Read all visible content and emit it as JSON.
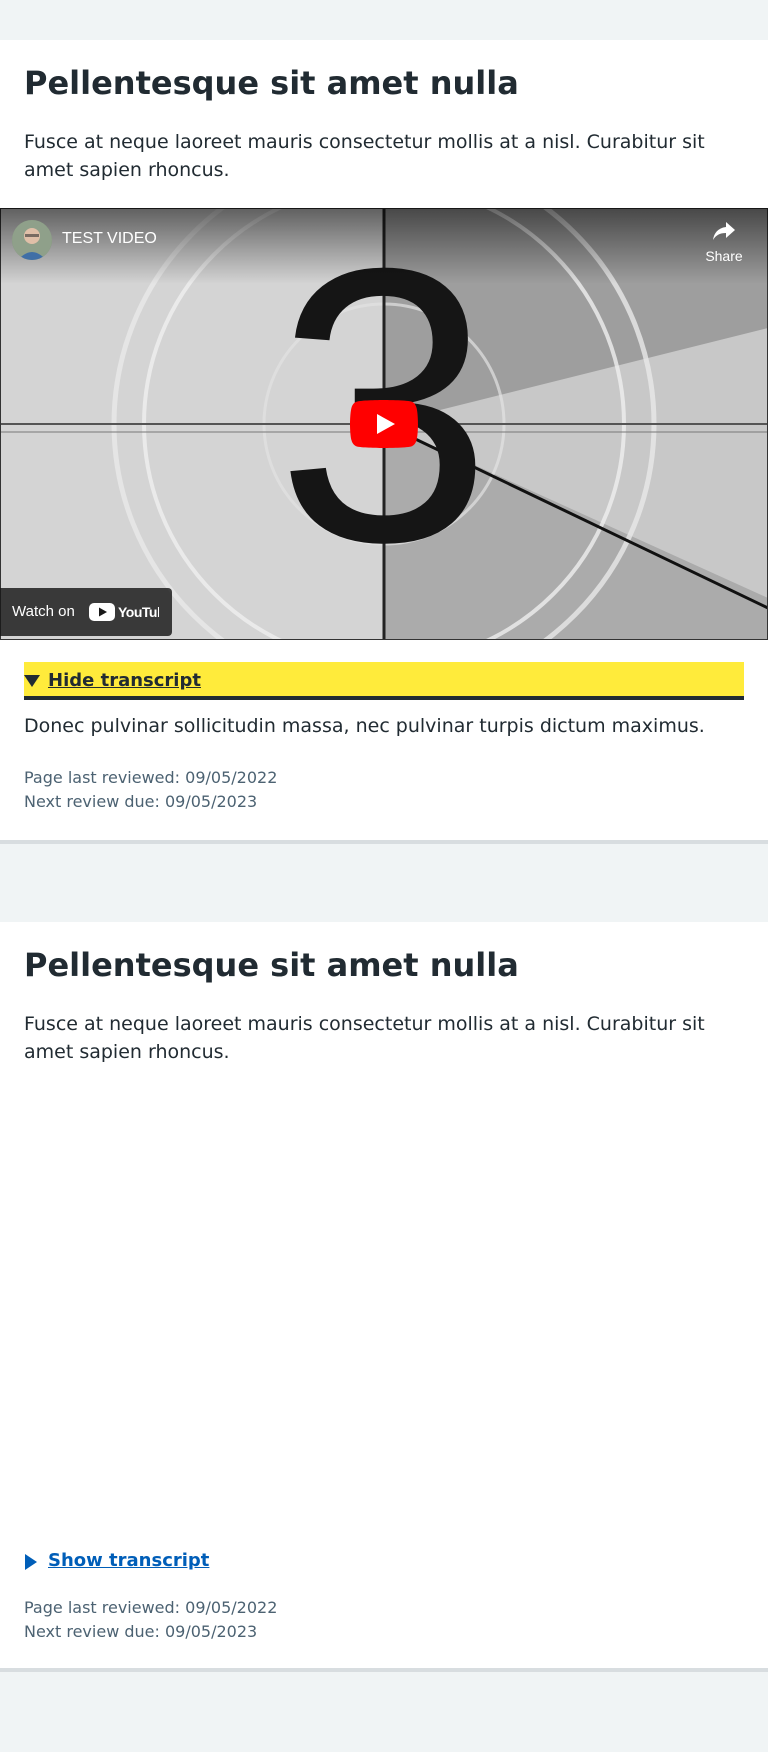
{
  "sections": [
    {
      "heading": "Pellentesque sit amet nulla",
      "intro": "Fusce at neque laoreet mauris consectetur mollis at a nisl. Curabitur sit amet sapien rhoncus.",
      "video": {
        "title": "TEST VIDEO",
        "share_label": "Share",
        "watch_on_label": "Watch on",
        "youtube_label": "YouTube",
        "countdown_number": "3"
      },
      "transcript_toggle": "Hide transcript",
      "transcript_expanded": true,
      "transcript_text": "Donec pulvinar sollicitudin massa, nec pulvinar turpis dictum maximus.",
      "last_reviewed": "Page last reviewed: 09/05/2022",
      "next_review": "Next review due: 09/05/2023"
    },
    {
      "heading": "Pellentesque sit amet nulla",
      "intro": "Fusce at neque laoreet mauris consectetur mollis at a nisl. Curabitur sit amet sapien rhoncus.",
      "transcript_toggle": "Show transcript",
      "transcript_expanded": false,
      "last_reviewed": "Page last reviewed: 09/05/2022",
      "next_review": "Next review due: 09/05/2023"
    }
  ],
  "colors": {
    "page_background": "#f0f4f5",
    "card_background": "#ffffff",
    "text": "#212b32",
    "secondary_text": "#4c6272",
    "link": "#005eb8",
    "focus_yellow": "#ffeb3b",
    "youtube_red": "#ff0000"
  }
}
